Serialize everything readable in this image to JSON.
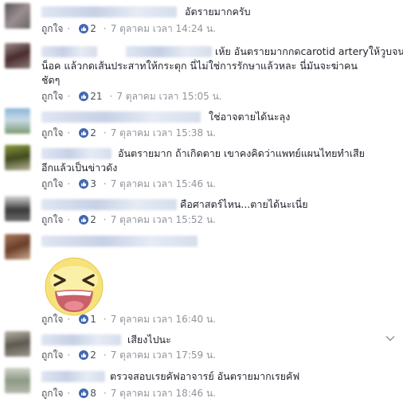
{
  "comments": [
    {
      "text": "อัตรายมากครับ",
      "like_label": "ถูกใจ",
      "likes": "2",
      "time": "7 ตุลาคม เวลา 14:24 น."
    },
    {
      "text_line1": "เห้ย อันตรายมากกดcarotid arteryให้วูบจน",
      "text_line2": "น็อค แล้วกดเส้นประสาทให้กระตุก นี่ไม่ใช่การรักษาแล้วหละ นี่มันจะฆ่าคน",
      "text_line3": "ชัดๆ",
      "like_label": "ถูกใจ",
      "likes": "21",
      "time": "7 ตุลาคม เวลา 15:05 น."
    },
    {
      "text": "ใช่อาจตายได้นะลุง",
      "like_label": "ถูกใจ",
      "likes": "2",
      "time": "7 ตุลาคม เวลา 15:38 น."
    },
    {
      "text_line1": "อันตรายมาก ถ้าเกิดตาย เขาคงคิดว่าแพทย์แผนไทยทำเสีย",
      "text_line2": "อีกแล้วเป็นข่าวดัง",
      "like_label": "ถูกใจ",
      "likes": "3",
      "time": "7 ตุลาคม เวลา 15:46 น."
    },
    {
      "text": "คือศาสตร์ไหน...ตายได้นะเนี่ย",
      "like_label": "ถูกใจ",
      "likes": "2",
      "time": "7 ตุลาคม เวลา 15:52 น."
    },
    {
      "like_label": "ถูกใจ",
      "likes": "1",
      "time": "7 ตุลาคม เวลา 16:40 น."
    },
    {
      "text": "เสียงไปนะ",
      "like_label": "ถูกใจ",
      "likes": "2",
      "time": "7 ตุลาคม เวลา 17:59 น."
    },
    {
      "text": "ตรวจสอบเรยคัฟอาจารย์ อันตรายมากเรยคัฟ",
      "like_label": "ถูกใจ",
      "likes": "8",
      "time": "7 ตุลาคม เวลา 18:46 น."
    }
  ],
  "colors": {
    "like_blue": "#4267b2",
    "meta_gray": "#90949c"
  },
  "icons": {
    "like": "thumbs-up-icon",
    "options": "chevron-down-icon"
  }
}
